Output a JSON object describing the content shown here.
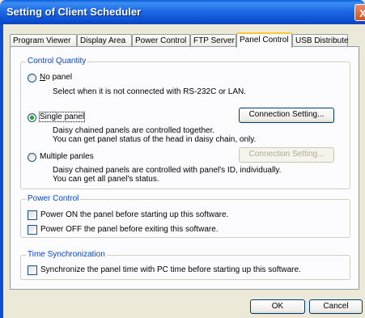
{
  "window": {
    "title": "Setting of Client Scheduler",
    "close_glyph": "X"
  },
  "tabs": [
    {
      "label": "Program Viewer"
    },
    {
      "label": "Display Area"
    },
    {
      "label": "Power Control"
    },
    {
      "label": "FTP Server"
    },
    {
      "label": "Panel Control",
      "active": true
    },
    {
      "label": "USB Distribute"
    }
  ],
  "control_quantity": {
    "legend": "Control Quantity",
    "no_panel": {
      "label": "No panel",
      "hotkey": "N",
      "rest": "o panel",
      "selected": false,
      "desc": "Select when it is not connected with RS-232C or LAN."
    },
    "single_panel": {
      "label": "Single panel",
      "selected": true,
      "desc1": "Daisy chained panels are controlled together.",
      "desc2": "You can get panel status of the head in daisy chain, only."
    },
    "single_connection_button": "Connection Setting...",
    "multiple_panels": {
      "label": "Multiple panles",
      "selected": false,
      "desc1": "Daisy chained panels are controlled with panel's ID, individually.",
      "desc2": "You can get all panel's status."
    },
    "multiple_connection_button": "Connection Setting..."
  },
  "power_control": {
    "legend": "Power Control",
    "on_before_start": {
      "label": "Power ON the panel before starting up this software.",
      "checked": false
    },
    "off_before_exit": {
      "label": "Power OFF the panel before exiting this software.",
      "checked": false
    }
  },
  "time_sync": {
    "legend": "Time Synchronization",
    "sync": {
      "label": "Synchronize the panel time with PC time before starting up this software.",
      "checked": false
    }
  },
  "footer": {
    "ok": "OK",
    "cancel": "Cancel"
  },
  "colors": {
    "title_bar": "#0b4fd0",
    "dialog_bg": "#ece9d8",
    "legend_text": "#0046d5",
    "active_tab_highlight": "#ffc83c"
  }
}
